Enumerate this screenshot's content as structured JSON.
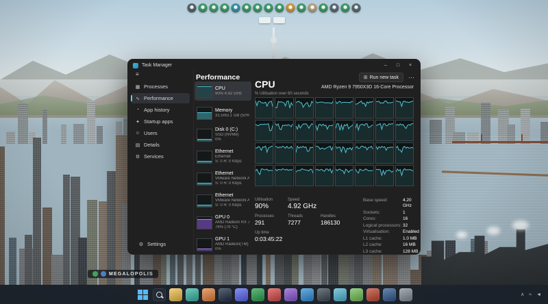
{
  "colors": {
    "accent": "#60cdff",
    "cpu_graph": "#53c6d4",
    "gpu_graph": "#9a5cf0"
  },
  "game": {
    "city_name": "MEGALOPOLIS",
    "toolbar_icons": [
      {
        "name": "bulldoze-tool-icon",
        "color": "#54656b"
      },
      {
        "name": "zoning-tool-icon",
        "color": "#3f9a6a"
      },
      {
        "name": "roads-tool-icon",
        "color": "#3f9a6a"
      },
      {
        "name": "electricity-tool-icon",
        "color": "#3f9a6a"
      },
      {
        "name": "water-tool-icon",
        "color": "#3b8fa3"
      },
      {
        "name": "health-tool-icon",
        "color": "#3f9a6a"
      },
      {
        "name": "fire-tool-icon",
        "color": "#3f9a6a"
      },
      {
        "name": "police-tool-icon",
        "color": "#3f9a6a"
      },
      {
        "name": "education-tool-icon",
        "color": "#3f9a6a"
      },
      {
        "name": "transport-tool-icon",
        "color": "#c9963f"
      },
      {
        "name": "parks-tool-icon",
        "color": "#3f9a6a"
      },
      {
        "name": "industry-tool-icon",
        "color": "#b5a27c"
      },
      {
        "name": "economy-tool-icon",
        "color": "#3f9a6a"
      },
      {
        "name": "info-views-icon",
        "color": "#5b6a72"
      },
      {
        "name": "map-tiles-icon",
        "color": "#3f9a6a"
      },
      {
        "name": "photo-mode-icon",
        "color": "#5b6a72"
      }
    ]
  },
  "task_manager": {
    "title": "Task Manager",
    "window_controls": {
      "minimize": "–",
      "maximize": "□",
      "close": "×"
    },
    "header": {
      "title": "Performance",
      "run_icon": "⊞",
      "run_new_task_label": "Run new task",
      "more": "⋯"
    },
    "sidebar": {
      "menu_icon": "≡",
      "items": [
        {
          "label": "Processes",
          "icon": "▦"
        },
        {
          "label": "Performance",
          "icon": "∿"
        },
        {
          "label": "App history",
          "icon": "◔"
        },
        {
          "label": "Startup apps",
          "icon": "✦"
        },
        {
          "label": "Users",
          "icon": "☺"
        },
        {
          "label": "Details",
          "icon": "▤"
        },
        {
          "label": "Services",
          "icon": "⚙"
        }
      ],
      "settings": {
        "label": "Settings",
        "icon": "⚙"
      }
    },
    "perf_items": [
      {
        "title": "CPU",
        "line2": "90% 4.92 GHz"
      },
      {
        "title": "Memory",
        "line2": "31.5/63.1 GB (50%)"
      },
      {
        "title": "Disk 0 (C:)",
        "line2": "SSD (NVMe)",
        "line3": "0%"
      },
      {
        "title": "Ethernet",
        "line2": "Ethernet",
        "line3": "S: 0 R: 0 Kbps"
      },
      {
        "title": "Ethernet",
        "line2": "VMware Network Ad...",
        "line3": "S: 0 R: 0 Kbps"
      },
      {
        "title": "Ethernet",
        "line2": "VMware Network Ad...",
        "line3": "S: 0 R: 0 Kbps"
      },
      {
        "title": "GPU 0",
        "line2": "AMD Radeon RX 790...",
        "line3": "76% (79 °C)"
      },
      {
        "title": "GPU 1",
        "line2": "AMD Radeon(TM) Gr...",
        "line3": "0%"
      }
    ],
    "cpu_panel": {
      "title": "CPU",
      "subtitle": "AMD Ryzen 9 7950X3D 16-Core Processor",
      "graph_label": "% Utilisation over 60 seconds",
      "grid": {
        "rows": 4,
        "cols": 8
      },
      "stats_top": [
        {
          "label": "Utilisation",
          "value": "90%"
        },
        {
          "label": "Speed",
          "value": "4.92 GHz"
        }
      ],
      "stats_counts": [
        {
          "label": "Processes",
          "value": "291"
        },
        {
          "label": "Threads",
          "value": "7277"
        },
        {
          "label": "Handles",
          "value": "186130"
        }
      ],
      "uptime": {
        "label": "Up time",
        "value": "0:03:45:22"
      },
      "stats_right": [
        {
          "label": "Base speed:",
          "value": "4.20 GHz"
        },
        {
          "label": "Sockets:",
          "value": "1"
        },
        {
          "label": "Cores:",
          "value": "16"
        },
        {
          "label": "Logical processors:",
          "value": "32"
        },
        {
          "label": "Virtualisation:",
          "value": "Enabled"
        },
        {
          "label": "L1 cache:",
          "value": "1.0 MB"
        },
        {
          "label": "L2 cache:",
          "value": "16 MB"
        },
        {
          "label": "L3 cache:",
          "value": "128 MB"
        }
      ]
    }
  },
  "taskbar": {
    "icons": [
      {
        "name": "start-button",
        "style": "windows",
        "color": "#58b9f2"
      },
      {
        "name": "search-button",
        "style": "search",
        "color": "#242b36"
      },
      {
        "name": "taskbar-app-icon",
        "color": "#f0c04a"
      },
      {
        "name": "taskbar-app-icon",
        "color": "#35b8a5"
      },
      {
        "name": "taskbar-app-icon",
        "color": "#e8823a"
      },
      {
        "name": "taskbar-app-icon",
        "color": "#1d2c44"
      },
      {
        "name": "taskbar-app-icon",
        "color": "#5865f2"
      },
      {
        "name": "taskbar-app-icon",
        "color": "#28a14c"
      },
      {
        "name": "taskbar-app-icon",
        "color": "#d94848"
      },
      {
        "name": "taskbar-app-icon",
        "color": "#8857d6"
      },
      {
        "name": "taskbar-app-icon",
        "color": "#2f8fd9"
      },
      {
        "name": "taskbar-app-icon",
        "color": "#3b4652"
      },
      {
        "name": "taskbar-app-icon",
        "color": "#4fb8d4"
      },
      {
        "name": "taskbar-app-icon",
        "color": "#70c054"
      },
      {
        "name": "taskbar-app-icon",
        "color": "#c2452f"
      },
      {
        "name": "taskbar-app-icon",
        "color": "#30588f"
      },
      {
        "name": "taskbar-app-icon",
        "color": "#888f99"
      }
    ],
    "tray_icons": [
      {
        "name": "tray-chevron-up-icon",
        "glyph": "∧"
      },
      {
        "name": "network-icon",
        "glyph": "≈"
      },
      {
        "name": "volume-icon",
        "glyph": "◄"
      }
    ]
  }
}
